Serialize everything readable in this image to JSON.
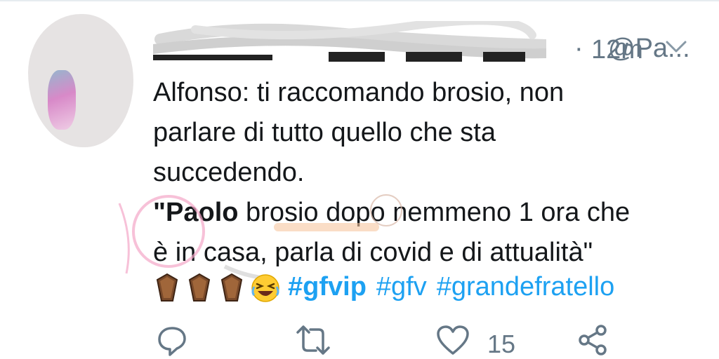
{
  "tweet": {
    "handle": "@Pa...",
    "separator": "·",
    "time": "12m",
    "line1": "Alfonso: ti raccomando brosio, non",
    "line2": "parlare di tutto quello che sta",
    "line3": "succedendo.",
    "line4_bold": "\"Paolo",
    "line4_rest": " brosio dopo nemmeno 1 ora che",
    "line5": "è in casa, parla di covid e di attualità\"",
    "hashtags": [
      "#gfvip",
      "#gfv",
      "#grandefratello"
    ],
    "emoji": [
      "coffin-emoji",
      "coffin-emoji",
      "coffin-emoji",
      "laughing-emoji"
    ]
  },
  "actions": {
    "like_count": "15",
    "icons": [
      "reply-icon",
      "retweet-icon",
      "like-icon",
      "share-icon"
    ]
  },
  "colors": {
    "link": "#1da1f2",
    "muted": "#657786",
    "text": "#14171a"
  }
}
